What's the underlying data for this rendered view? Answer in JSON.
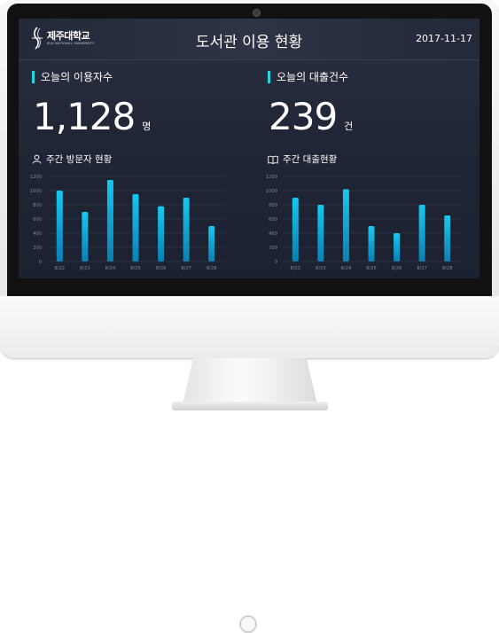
{
  "header": {
    "logo_ko": "제주대학교",
    "logo_en": "JEJU NATIONAL UNIVERSITY",
    "title": "도서관 이용 현황",
    "date": "2017-11-17"
  },
  "visitors": {
    "title": "오늘의 이용자수",
    "count": "1,128",
    "unit": "명",
    "weekly_title": "주간 방문자 현황",
    "icon": "user-icon"
  },
  "loans": {
    "title": "오늘의 대출건수",
    "count": "239",
    "unit": "건",
    "weekly_title": "주간 대출현황",
    "icon": "book-icon"
  },
  "colors": {
    "accent": "#22d3e3",
    "bar_top": "#18c8ee",
    "bar_bottom": "#0a7fb4",
    "background": "#202635"
  },
  "chart_data": [
    {
      "type": "bar",
      "categories": [
        "8/22",
        "8/23",
        "8/24",
        "8/25",
        "8/26",
        "8/27",
        "8/28"
      ],
      "values": [
        1000,
        700,
        1150,
        950,
        780,
        900,
        500
      ],
      "yticks": [
        0,
        200,
        400,
        600,
        800,
        1000,
        1200
      ],
      "ylim": [
        0,
        1200
      ],
      "grid": true
    },
    {
      "type": "bar",
      "categories": [
        "8/22",
        "8/23",
        "8/24",
        "8/25",
        "8/26",
        "8/27",
        "8/28"
      ],
      "values": [
        900,
        800,
        1020,
        500,
        400,
        800,
        650
      ],
      "yticks": [
        0,
        200,
        400,
        600,
        800,
        1000,
        1200
      ],
      "ylim": [
        0,
        1200
      ],
      "grid": true
    }
  ]
}
